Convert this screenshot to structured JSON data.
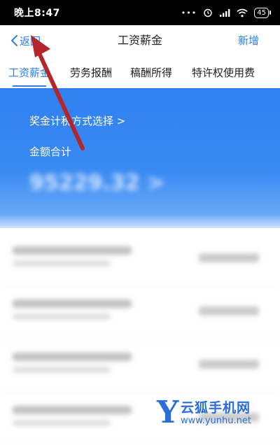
{
  "status": {
    "time": "晚上8:47",
    "battery": "45"
  },
  "nav": {
    "back_label": "返回",
    "title": "工资薪金",
    "add_label": "新增"
  },
  "tabs": [
    {
      "label": "工资薪金",
      "active": true
    },
    {
      "label": "劳务报酬",
      "active": false
    },
    {
      "label": "稿酬所得",
      "active": false
    },
    {
      "label": "特许权使用费",
      "active": false
    }
  ],
  "panel": {
    "bonus_link": "奖金计税方式选择 >",
    "sum_label": "金额合计",
    "sum_value": "95229.32 >"
  },
  "list": {
    "row_count": 4
  },
  "colors": {
    "accent": "#2b7de9",
    "panel": "#2f7ff0",
    "arrow": "#b3262b"
  },
  "watermark": {
    "logo_letter": "Y",
    "name": "云狐手机网",
    "url": "www.yunhu.net"
  }
}
